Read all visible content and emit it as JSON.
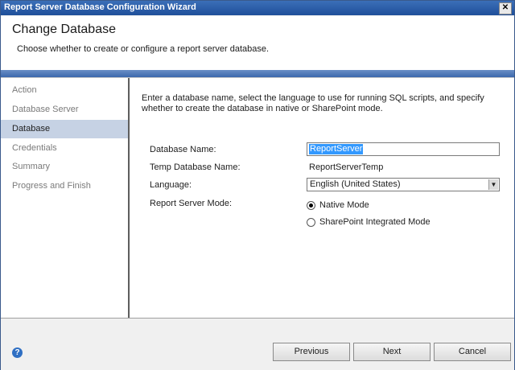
{
  "window": {
    "title": "Report Server Database Configuration Wizard"
  },
  "header": {
    "heading": "Change Database",
    "subtitle": "Choose whether to create or configure a report server database."
  },
  "sidebar": {
    "items": [
      {
        "label": "Action"
      },
      {
        "label": "Database Server"
      },
      {
        "label": "Database"
      },
      {
        "label": "Credentials"
      },
      {
        "label": "Summary"
      },
      {
        "label": "Progress and Finish"
      }
    ],
    "active_index": 2
  },
  "content": {
    "intro": "Enter a database name, select the language to use for running SQL scripts, and specify whether to create the database in native or SharePoint mode.",
    "database_name_label": "Database Name:",
    "database_name_value": "ReportServer",
    "temp_database_label": "Temp Database Name:",
    "temp_database_value": "ReportServerTemp",
    "language_label": "Language:",
    "language_value": "English (United States)",
    "mode_label": "Report Server Mode:",
    "mode_options": [
      {
        "label": "Native Mode",
        "checked": true
      },
      {
        "label": "SharePoint Integrated Mode",
        "checked": false
      }
    ]
  },
  "footer": {
    "help_glyph": "?",
    "previous_label": "Previous",
    "next_label": "Next",
    "cancel_label": "Cancel"
  },
  "colors": {
    "title_bar": "#2a5ca8",
    "header_band": "#4b74b5",
    "active_nav": "#c6d2e4",
    "selection": "#3399ff"
  }
}
